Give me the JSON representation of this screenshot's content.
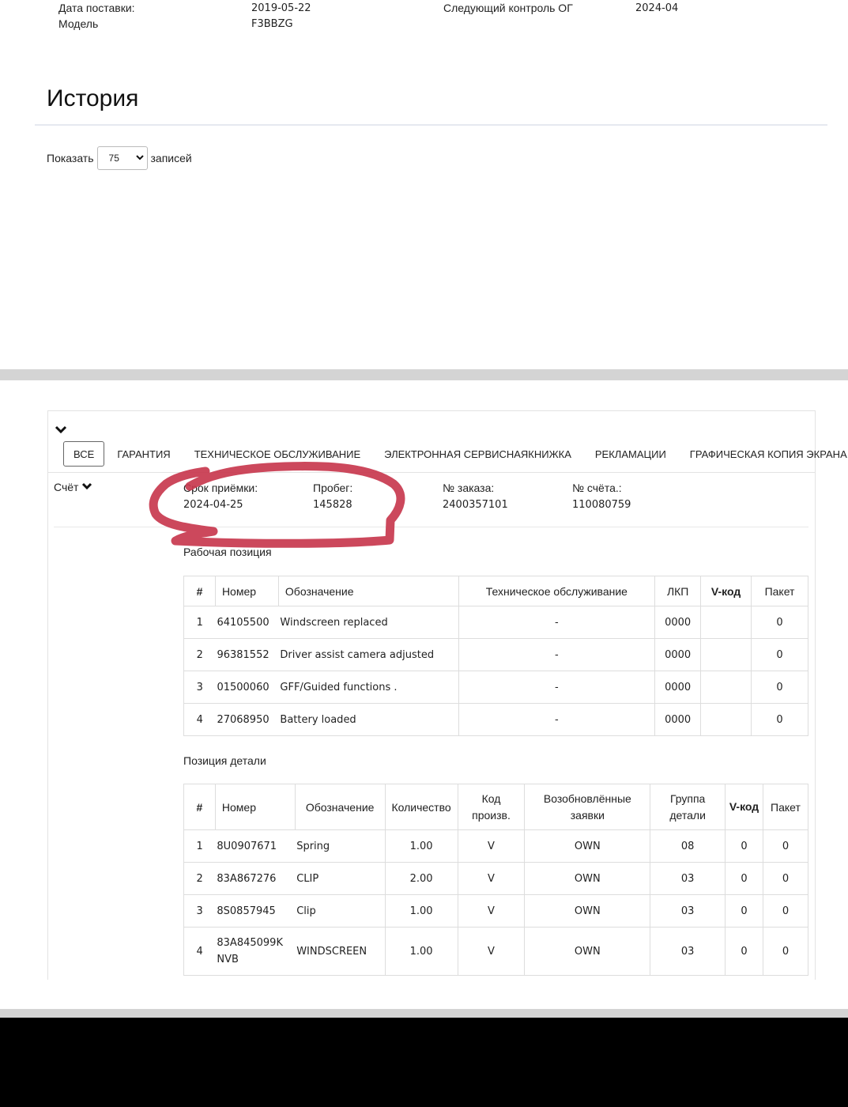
{
  "vehicle": {
    "delivery_date_label": "Дата поставки:",
    "delivery_date_value": "2019-05-22",
    "model_label": "Модель",
    "model_value": "F3BBZG",
    "next_check_label": "Следующий контроль ОГ",
    "next_check_value": "2024-04"
  },
  "history": {
    "title": "История",
    "show_label": "Показать",
    "entries_value": "75",
    "entries_label": "записей"
  },
  "tabs": [
    {
      "label": "ВСЕ",
      "active": true
    },
    {
      "label": "ГАРАНТИЯ"
    },
    {
      "label": "ТЕХНИЧЕСКОЕ ОБСЛУЖИВАНИЕ"
    },
    {
      "label": "ЭЛЕКТРОННАЯ СЕРВИСНАЯКНИЖКА"
    },
    {
      "label": "РЕКЛАМАЦИИ"
    },
    {
      "label": "ГРАФИЧЕСКАЯ КОПИЯ ЭКРАНА"
    }
  ],
  "invoice": {
    "label": "Счёт",
    "fields": [
      {
        "label": "Срок приёмки:",
        "value": "2024-04-25"
      },
      {
        "label": "Пробег:",
        "value": "145828"
      },
      {
        "label": "№ заказа:",
        "value": "2400357101"
      },
      {
        "label": "№ счёта.:",
        "value": "110080759"
      }
    ]
  },
  "work_positions": {
    "title": "Рабочая позиция",
    "headers": [
      "#",
      "Номер",
      "Обозначение",
      "Техническое обслуживание",
      "ЛКП",
      "V-код",
      "Пакет"
    ],
    "rows": [
      [
        "1",
        "64105500",
        "Windscreen replaced",
        "-",
        "0000",
        "",
        "0"
      ],
      [
        "2",
        "96381552",
        "Driver assist camera adjusted",
        "-",
        "0000",
        "",
        "0"
      ],
      [
        "3",
        "01500060",
        "GFF/Guided functions .",
        "-",
        "0000",
        "",
        "0"
      ],
      [
        "4",
        "27068950",
        "Battery loaded",
        "-",
        "0000",
        "",
        "0"
      ]
    ]
  },
  "part_positions": {
    "title": "Позиция детали",
    "headers": [
      "#",
      "Номер",
      "Обозначение",
      "Количество",
      "Код произв.",
      "Возобновлённые заявки",
      "Группа детали",
      "V-код",
      "Пакет"
    ],
    "rows": [
      [
        "1",
        "8U0907671",
        "Spring",
        "1.00",
        "V",
        "OWN",
        "08",
        "0",
        "0"
      ],
      [
        "2",
        "83A867276",
        "CLIP",
        "2.00",
        "V",
        "OWN",
        "03",
        "0",
        "0"
      ],
      [
        "3",
        "8S0857945",
        "Clip",
        "1.00",
        "V",
        "OWN",
        "03",
        "0",
        "0"
      ],
      [
        "4",
        "83A845099K NVB",
        "WINDSCREEN",
        "1.00",
        "V",
        "OWN",
        "03",
        "0",
        "0"
      ]
    ]
  },
  "colors": {
    "marker_red": "#c8384e"
  }
}
